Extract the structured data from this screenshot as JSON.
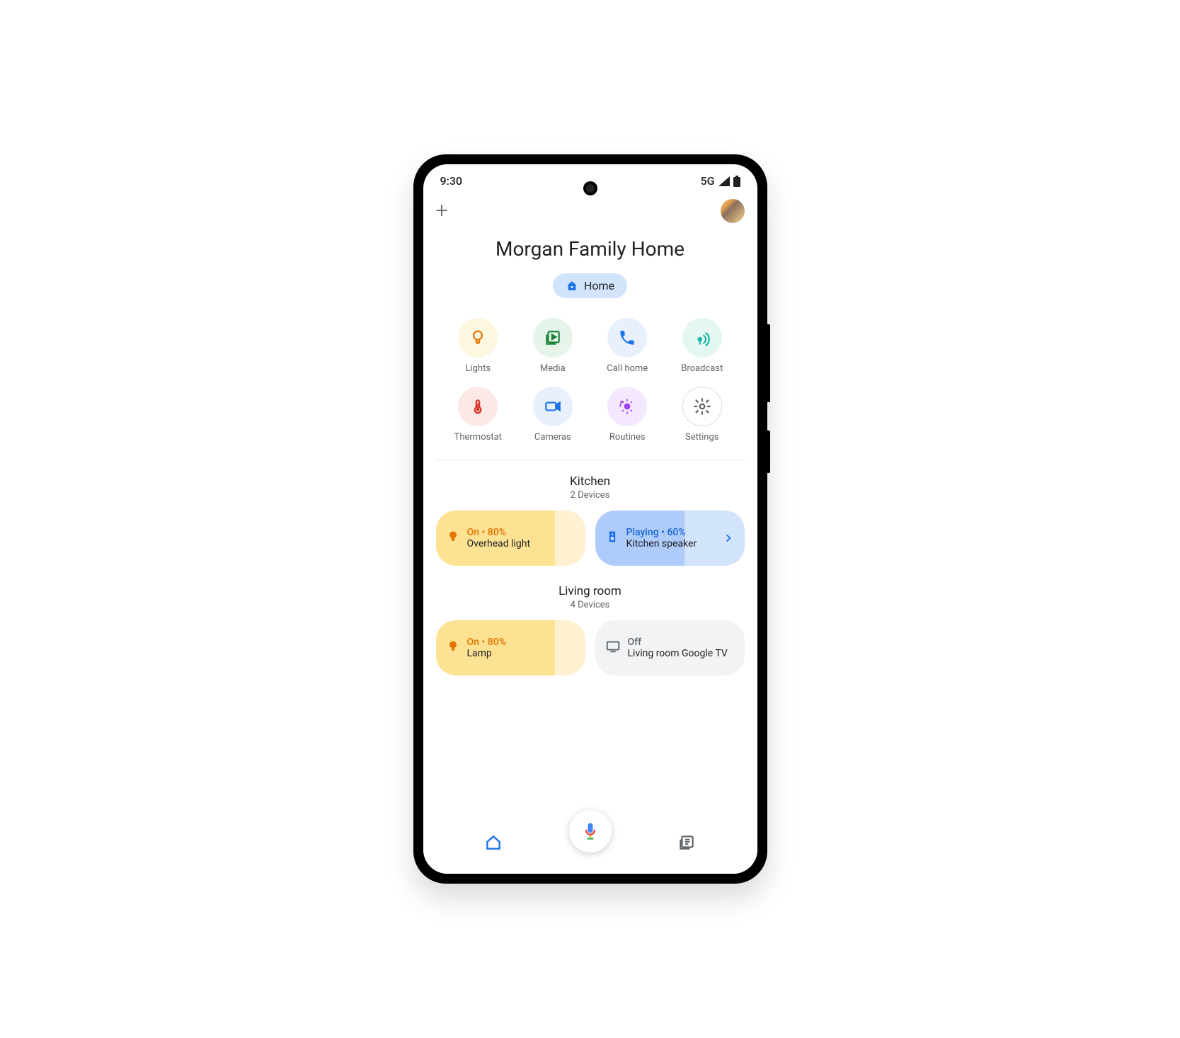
{
  "status": {
    "time": "9:30",
    "network": "5G"
  },
  "title": "Morgan Family Home",
  "chip": {
    "label": "Home"
  },
  "quick": [
    {
      "label": "Lights",
      "bg": "bg-yellow",
      "icon": "bulb",
      "color": "#e37400"
    },
    {
      "label": "Media",
      "bg": "bg-green",
      "icon": "media",
      "color": "#188038"
    },
    {
      "label": "Call home",
      "bg": "bg-blue",
      "icon": "phone",
      "color": "#1a73e8"
    },
    {
      "label": "Broadcast",
      "bg": "bg-teal",
      "icon": "broadcast",
      "color": "#12b5a5"
    },
    {
      "label": "Thermostat",
      "bg": "bg-red",
      "icon": "thermo",
      "color": "#d93025"
    },
    {
      "label": "Cameras",
      "bg": "bg-blue",
      "icon": "camera",
      "color": "#1a73e8"
    },
    {
      "label": "Routines",
      "bg": "bg-purple",
      "icon": "routine",
      "color": "#a142f4"
    },
    {
      "label": "Settings",
      "bg": "bg-white",
      "icon": "gear",
      "color": "#5f6368"
    }
  ],
  "rooms": [
    {
      "name": "Kitchen",
      "sub": "2 Devices",
      "cards": [
        {
          "type": "light",
          "status": "On • 80%",
          "name": "Overhead light",
          "fill": 80
        },
        {
          "type": "speaker",
          "status": "Playing • 60%",
          "name": "Kitchen speaker",
          "fill": 60,
          "chevron": true
        }
      ]
    },
    {
      "name": "Living room",
      "sub": "4 Devices",
      "cards": [
        {
          "type": "light",
          "status": "On • 80%",
          "name": "Lamp",
          "fill": 80
        },
        {
          "type": "off",
          "status": "Off",
          "name": "Living room Google TV",
          "fill": 0
        }
      ]
    }
  ]
}
